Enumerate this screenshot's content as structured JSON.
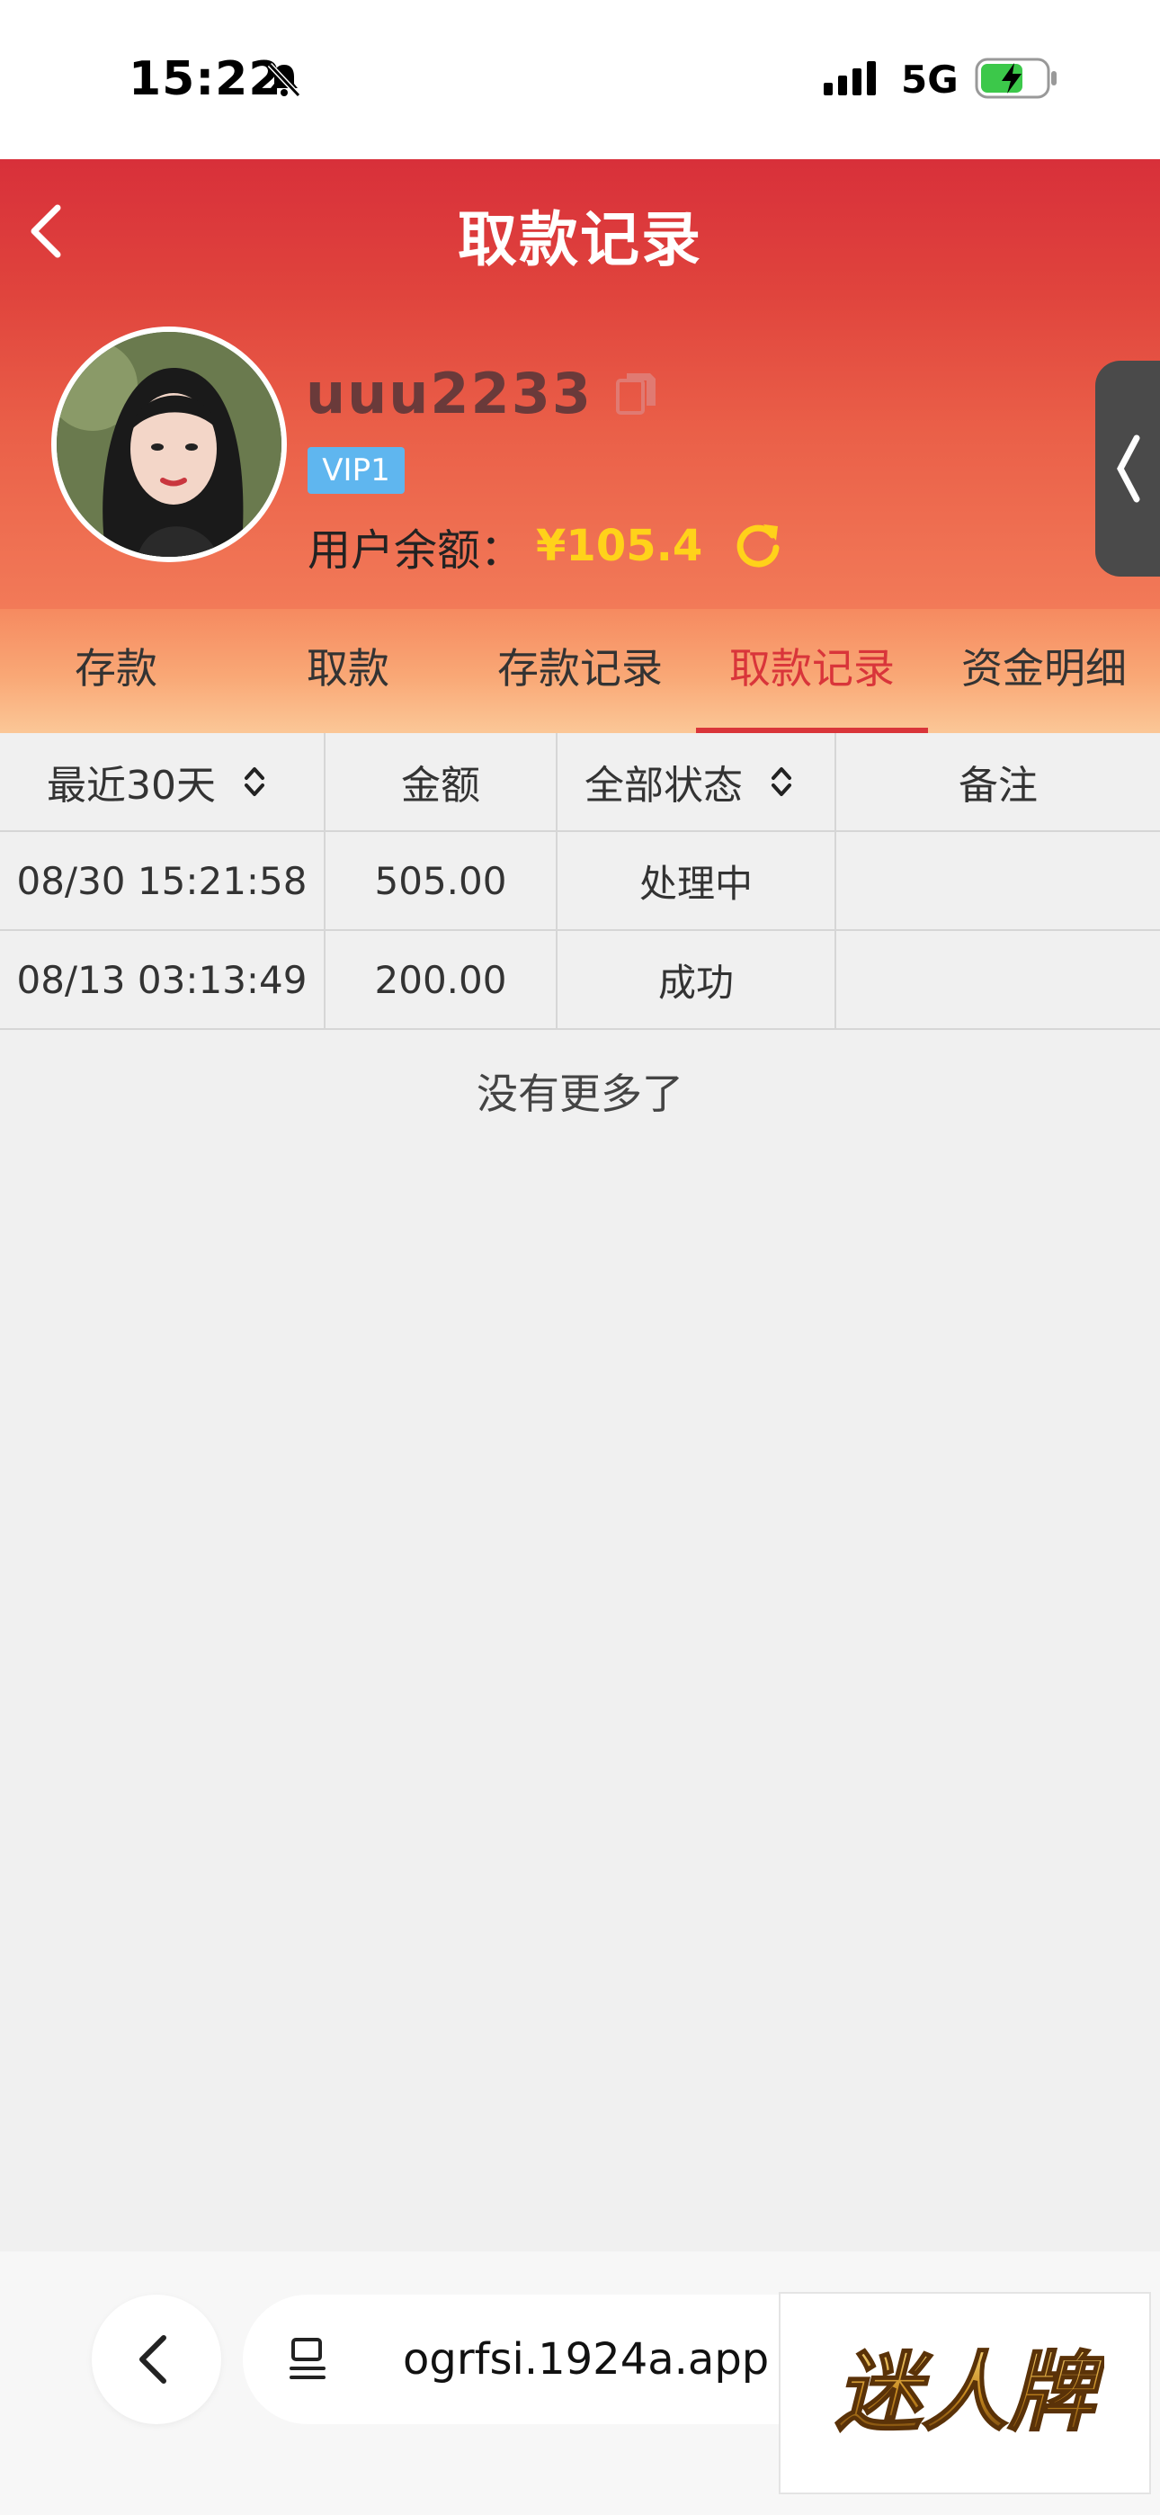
{
  "status_bar": {
    "time": "15:22",
    "network": "5G",
    "icons": [
      "bell-slash-icon",
      "signal-icon",
      "battery-charging-icon"
    ]
  },
  "header": {
    "title": "取款记录",
    "back_icon": "chevron-left-icon",
    "username": "uuu2233",
    "copy_icon": "copy-icon",
    "vip_label": "VIP1",
    "balance_label": "用户余额：",
    "balance_value": "¥105.4",
    "refresh_icon": "refresh-icon"
  },
  "tabs": [
    {
      "label": "存款",
      "active": false
    },
    {
      "label": "取款",
      "active": false
    },
    {
      "label": "存款记录",
      "active": false
    },
    {
      "label": "取款记录",
      "active": true
    },
    {
      "label": "资金明细",
      "active": false
    }
  ],
  "table": {
    "headers": {
      "date_filter": "最近30天",
      "amount": "金额",
      "status_filter": "全部状态",
      "remark": "备注"
    },
    "rows": [
      {
        "time": "08/30 15:21:58",
        "amount": "505.00",
        "status": "处理中",
        "remark": ""
      },
      {
        "time": "08/13 03:13:49",
        "amount": "200.00",
        "status": "成功",
        "remark": ""
      }
    ],
    "end_text": "没有更多了"
  },
  "browser": {
    "url": "ogrfsi.1924a.app",
    "logo_text": "迷人牌"
  },
  "colors": {
    "header_red": "#d8303a",
    "active_tab": "#d9353a",
    "balance_yellow": "#ffd21a",
    "vip_blue": "#5fb6ef"
  }
}
